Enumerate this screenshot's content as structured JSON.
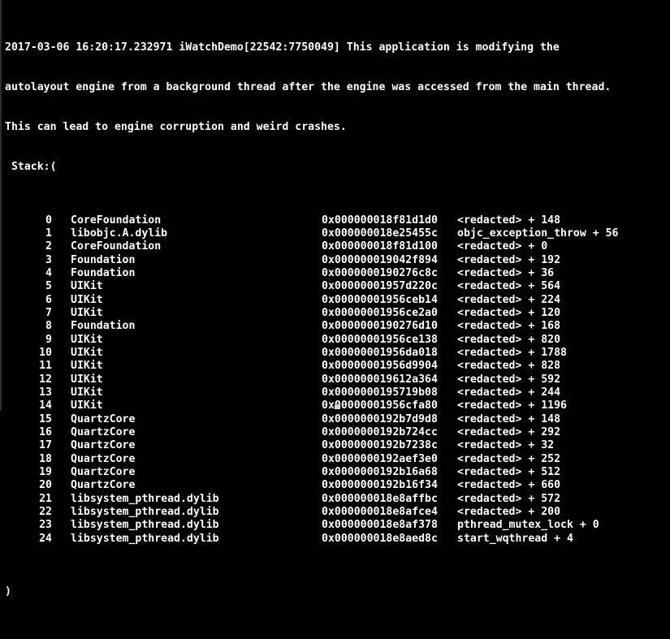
{
  "log": {
    "timestamp": "2017-03-06 16:20:17.232971",
    "process": "iWatchDemo[22542:7750049]",
    "message_line_1": "2017-03-06 16:20:17.232971 iWatchDemo[22542:7750049] This application is modifying the",
    "message_line_2": "autolayout engine from a background thread after the engine was accessed from the main thread.",
    "message_line_3": "This can lead to engine corruption and weird crashes.",
    "stack_open": " Stack:(",
    "stack_close": ")"
  },
  "colors": {
    "background": "#000000",
    "text": "#ffffff",
    "cursor": "#d8d8d8",
    "left_border": "#2e2e2e"
  },
  "stack": [
    {
      "index": "0",
      "library": "CoreFoundation",
      "address": "0x000000018f81d1d0",
      "symbol": "<redacted> + 148"
    },
    {
      "index": "1",
      "library": "libobjc.A.dylib",
      "address": "0x000000018e25455c",
      "symbol": "objc_exception_throw + 56"
    },
    {
      "index": "2",
      "library": "CoreFoundation",
      "address": "0x000000018f81d100",
      "symbol": "<redacted> + 0"
    },
    {
      "index": "3",
      "library": "Foundation",
      "address": "0x000000019042f894",
      "symbol": "<redacted> + 192"
    },
    {
      "index": "4",
      "library": "Foundation",
      "address": "0x0000000190276c8c",
      "symbol": "<redacted> + 36"
    },
    {
      "index": "5",
      "library": "UIKit",
      "address": "0x00000001957d220c",
      "symbol": "<redacted> + 564"
    },
    {
      "index": "6",
      "library": "UIKit",
      "address": "0x00000001956ceb14",
      "symbol": "<redacted> + 224"
    },
    {
      "index": "7",
      "library": "UIKit",
      "address": "0x00000001956ce2a0",
      "symbol": "<redacted> + 120"
    },
    {
      "index": "8",
      "library": "Foundation",
      "address": "0x0000000190276d10",
      "symbol": "<redacted> + 168"
    },
    {
      "index": "9",
      "library": "UIKit",
      "address": "0x00000001956ce138",
      "symbol": "<redacted> + 820"
    },
    {
      "index": "10",
      "library": "UIKit",
      "address": "0x00000001956da018",
      "symbol": "<redacted> + 1788"
    },
    {
      "index": "11",
      "library": "UIKit",
      "address": "0x00000001956d9904",
      "symbol": "<redacted> + 828"
    },
    {
      "index": "12",
      "library": "UIKit",
      "address": "0x000000019612a364",
      "symbol": "<redacted> + 592"
    },
    {
      "index": "13",
      "library": "UIKit",
      "address": "0x0000000195719b08",
      "symbol": "<redacted> + 244"
    },
    {
      "index": "14",
      "library": "UIKit",
      "address": "0x00000001956cfa80",
      "symbol": "<redacted> + 1196"
    },
    {
      "index": "15",
      "library": "QuartzCore",
      "address": "0x0000000192b7d9d8",
      "symbol": "<redacted> + 148"
    },
    {
      "index": "16",
      "library": "QuartzCore",
      "address": "0x0000000192b724cc",
      "symbol": "<redacted> + 292"
    },
    {
      "index": "17",
      "library": "QuartzCore",
      "address": "0x0000000192b7238c",
      "symbol": "<redacted> + 32"
    },
    {
      "index": "18",
      "library": "QuartzCore",
      "address": "0x0000000192aef3e0",
      "symbol": "<redacted> + 252"
    },
    {
      "index": "19",
      "library": "QuartzCore",
      "address": "0x0000000192b16a68",
      "symbol": "<redacted> + 512"
    },
    {
      "index": "20",
      "library": "QuartzCore",
      "address": "0x0000000192b16f34",
      "symbol": "<redacted> + 660"
    },
    {
      "index": "21",
      "library": "libsystem_pthread.dylib",
      "address": "0x000000018e8affbc",
      "symbol": "<redacted> + 572"
    },
    {
      "index": "22",
      "library": "libsystem_pthread.dylib",
      "address": "0x000000018e8afce4",
      "symbol": "<redacted> + 200"
    },
    {
      "index": "23",
      "library": "libsystem_pthread.dylib",
      "address": "0x000000018e8af378",
      "symbol": "pthread_mutex_lock + 0"
    },
    {
      "index": "24",
      "library": "libsystem_pthread.dylib",
      "address": "0x000000018e8aed8c",
      "symbol": "start_wqthread + 4"
    }
  ]
}
